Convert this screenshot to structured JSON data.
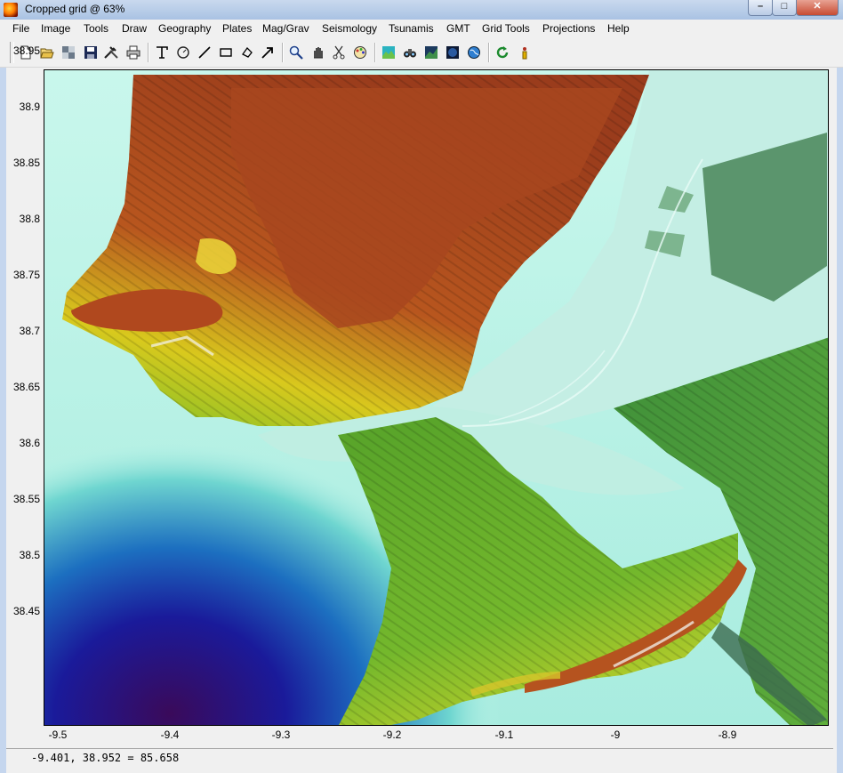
{
  "window": {
    "title": "Cropped grid  @  63%",
    "buttons": {
      "minimize": "–",
      "maximize": "□",
      "close": "✕"
    }
  },
  "menu": [
    "File",
    "Image",
    "Tools",
    "Draw",
    "Geography",
    "Plates",
    "Mag/Grav",
    "Seismology",
    "Tsunamis",
    "GMT",
    "Grid Tools",
    "Projections",
    "Help"
  ],
  "toolbar": {
    "icons": [
      "new-file-icon",
      "open-folder-icon",
      "image-icon",
      "save-icon",
      "tools-icon",
      "print-icon",
      "text-icon",
      "circle-icon",
      "line-icon",
      "rectangle-icon",
      "polygon-icon",
      "arrow-icon",
      "zoom-icon",
      "pan-icon",
      "scissors-icon",
      "colorbar-icon",
      "shaded-relief-icon",
      "binoculars-icon",
      "grid-view-icon",
      "earth-night-icon",
      "globe-icon",
      "refresh-icon",
      "info-icon"
    ]
  },
  "axes": {
    "y_ticks": [
      "38.95",
      "38.9",
      "38.85",
      "38.8",
      "38.75",
      "38.7",
      "38.65",
      "38.6",
      "38.55",
      "38.5",
      "38.45"
    ],
    "x_ticks": [
      "-9.5",
      "-9.4",
      "-9.3",
      "-9.2",
      "-9.1",
      "-9",
      "-8.9"
    ]
  },
  "status": {
    "readout": "-9.401, 38.952 = 85.658"
  }
}
